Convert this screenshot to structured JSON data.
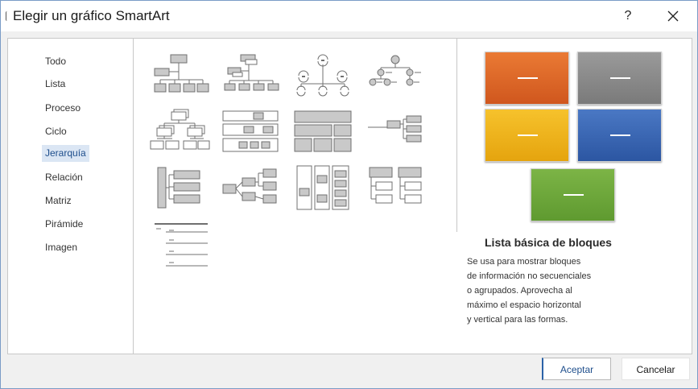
{
  "window": {
    "title": "Elegir un gráfico SmartArt",
    "help_label": "?"
  },
  "categories": [
    {
      "label": "Todo"
    },
    {
      "label": "Lista"
    },
    {
      "label": "Proceso"
    },
    {
      "label": "Ciclo"
    },
    {
      "label": "Jerarquía",
      "selected": true
    },
    {
      "label": "Relación"
    },
    {
      "label": "Matriz"
    },
    {
      "label": "Pirámide"
    },
    {
      "label": "Imagen"
    }
  ],
  "preview": {
    "title": "Lista básica de bloques",
    "description_lines": [
      "Se usa para mostrar bloques",
      "de información no secuenciales",
      "o agrupados. Aprovecha al",
      "máximo el espacio horizontal",
      "y vertical para las formas."
    ],
    "block_colors": [
      "#e0682a",
      "#8a8a8a",
      "#f2b51a",
      "#3a66b5",
      "#6ea83c"
    ]
  },
  "buttons": {
    "ok": "Aceptar",
    "cancel": "Cancelar"
  },
  "colors": {
    "selection_bg": "#dbe6f4",
    "thumb_fill": "#c9c9c9",
    "thumb_stroke": "#707070"
  }
}
